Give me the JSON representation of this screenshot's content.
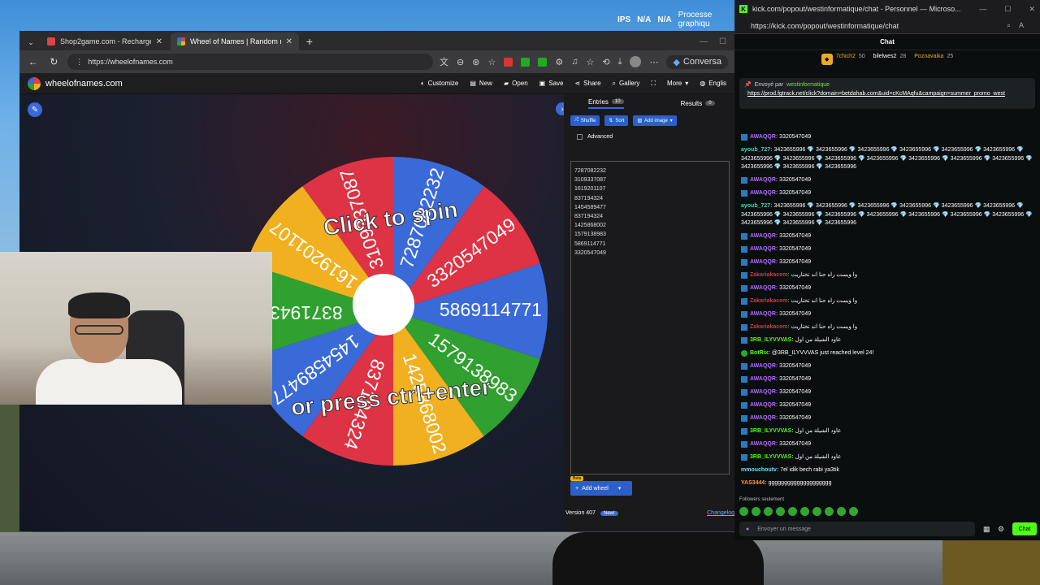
{
  "desktop": {
    "ips_label": "IPS",
    "na1": "N/A",
    "na2": "N/A",
    "proc_line1": "Processe",
    "proc_line2": "graphiqu"
  },
  "browser": {
    "tabs": [
      {
        "title": "Shop2game.com - Recharge offici",
        "fav_color": "#d44"
      },
      {
        "title": "Wheel of Names | Random name p",
        "fav_color": "#3a6ad8"
      }
    ],
    "url": "https://wheelofnames.com",
    "copilot_label": "Conversa"
  },
  "won": {
    "logo": "wheelofnames.com",
    "menu": [
      "Customize",
      "New",
      "Open",
      "Save",
      "Share",
      "Gallery",
      "More",
      "Englis"
    ],
    "wheel_text_top": "Click to spin",
    "wheel_text_bottom": "or press ctrl+enter",
    "entries_tab": "Entries",
    "entries_count": "10",
    "results_tab": "Results",
    "results_count": "0",
    "shuffle": "Shuffle",
    "sort": "Sort",
    "add_image": "Add image",
    "advanced": "Advanced",
    "entries": [
      "7287082232",
      "3109337087",
      "1619201107",
      "837194324",
      "1454589477",
      "837194324",
      "1425868002",
      "1579138983",
      "5869114771",
      "3320547049"
    ],
    "beta": "Beta",
    "add_wheel": "Add wheel",
    "version": "Version 407",
    "new": "New!",
    "changelog": "Changelog"
  },
  "wheel": {
    "segments": [
      {
        "label": "5869114771",
        "color": "#3a6ad8"
      },
      {
        "label": "1579138983",
        "color": "#30a030"
      },
      {
        "label": "1425868002",
        "color": "#f0b020"
      },
      {
        "label": "837194324",
        "color": "#dd3344"
      },
      {
        "label": "1454589477",
        "color": "#3a6ad8"
      },
      {
        "label": "837194324",
        "color": "#30a030"
      },
      {
        "label": "1619201107",
        "color": "#f0b020"
      },
      {
        "label": "3109337087",
        "color": "#dd3344"
      },
      {
        "label": "7287082232",
        "color": "#3a6ad8"
      },
      {
        "label": "3320547049",
        "color": "#dd3344"
      }
    ]
  },
  "kick": {
    "title": "kick.com/popout/westinformatique/chat - Personnel — Microso...",
    "url": "https://kick.com/popout/westinformatique/chat",
    "chat_header": "Chat",
    "leaders": [
      {
        "name": "7chich2",
        "score": "50"
      },
      {
        "name": "bilelwes2",
        "score": "28"
      },
      {
        "name": "Poznavaika",
        "score": "25"
      }
    ],
    "pinned_by": "Envoyé par",
    "pinned_user": "westinformatique",
    "pinned_link": "https://prod.fgtrack.net/click?domain=betdahab.com&uid=cKcMAqfu&campaign=summer_promo_west",
    "messages": [
      {
        "user": "AWAQQR:",
        "color": "#b26cff",
        "text": "3320547049",
        "badge": "bi"
      },
      {
        "user": "ayoub_727:",
        "color": "#4ad0c0",
        "text": "3423655996 💎 3423655996 💎 3423655996 💎 3423655996 💎 3423655996 💎 3423655996 💎 3423655996 💎 3423655996 💎 3423655996 💎 3423655996 💎 3423655996 💎 3423655996 💎 3423655996 💎 3423655996 💎 3423655996 💎 3423655996",
        "badge": ""
      },
      {
        "user": "AWAQQR:",
        "color": "#b26cff",
        "text": "3320547049",
        "badge": "bi"
      },
      {
        "user": "AWAQQR:",
        "color": "#b26cff",
        "text": "3320547049",
        "badge": "bi"
      },
      {
        "user": "ayoub_727:",
        "color": "#4ad0c0",
        "text": "3423655996 💎 3423655996 💎 3423655996 💎 3423655996 💎 3423655996 💎 3423655996 💎 3423655996 💎 3423655996 💎 3423655996 💎 3423655996 💎 3423655996 💎 3423655996 💎 3423655996 💎 3423655996 💎 3423655996 💎 3423655996",
        "badge": ""
      },
      {
        "user": "AWAQQR:",
        "color": "#b26cff",
        "text": "3320547049",
        "badge": "bi"
      },
      {
        "user": "AWAQQR:",
        "color": "#b26cff",
        "text": "3320547049",
        "badge": "bi"
      },
      {
        "user": "AWAQQR:",
        "color": "#b26cff",
        "text": "3320547049",
        "badge": "bi"
      },
      {
        "user": "Zakariakacem:",
        "color": "#e0304a",
        "text": "وا ويست راه حنا اند تختاريت",
        "badge": "bi"
      },
      {
        "user": "AWAQQR:",
        "color": "#b26cff",
        "text": "3320547049",
        "badge": "bi"
      },
      {
        "user": "Zakariakacem:",
        "color": "#e0304a",
        "text": "وا ويست راه حنا اند تختاريت",
        "badge": "bi"
      },
      {
        "user": "AWAQQR:",
        "color": "#b26cff",
        "text": "3320547049",
        "badge": "bi"
      },
      {
        "user": "Zakariakacem:",
        "color": "#e0304a",
        "text": "وا ويست راه حنا اند تختاريت",
        "badge": "bi"
      },
      {
        "user": "3RB_ILYVVVAS:",
        "color": "#53fc18",
        "text": "عاود الشيلة من اول",
        "badge": "bi"
      },
      {
        "user": "BotRix:",
        "color": "#53fc18",
        "text": "@3RB_ILYVVVAS just reached level 24!",
        "badge": "bb"
      },
      {
        "user": "AWAQQR:",
        "color": "#b26cff",
        "text": "3320547049",
        "badge": "bi"
      },
      {
        "user": "AWAQQR:",
        "color": "#b26cff",
        "text": "3320547049",
        "badge": "bi"
      },
      {
        "user": "AWAQQR:",
        "color": "#b26cff",
        "text": "3320547049",
        "badge": "bi"
      },
      {
        "user": "AWAQQR:",
        "color": "#b26cff",
        "text": "3320547049",
        "badge": "bi"
      },
      {
        "user": "AWAQQR:",
        "color": "#b26cff",
        "text": "3320547049",
        "badge": "bi"
      },
      {
        "user": "3RB_ILYVVVAS:",
        "color": "#53fc18",
        "text": "عاود الشيلة من اول",
        "badge": "bi"
      },
      {
        "user": "AWAQQR:",
        "color": "#b26cff",
        "text": "3320547049",
        "badge": "bi"
      },
      {
        "user": "3RB_ILYVVVAS:",
        "color": "#53fc18",
        "text": "عاود الشيلة من اول",
        "badge": "bi"
      },
      {
        "user": "mmouchoutv:",
        "color": "#7ad8ff",
        "text": "7el idik bech rabi ya3tik",
        "badge": ""
      },
      {
        "user": "YAS3444:",
        "color": "#ff9a3c",
        "text": "gggggggggggggggggggg",
        "badge": ""
      }
    ],
    "followers_only": "Followers seulement",
    "input_placeholder": "Envoyer un message",
    "chat_button": "Chat"
  }
}
